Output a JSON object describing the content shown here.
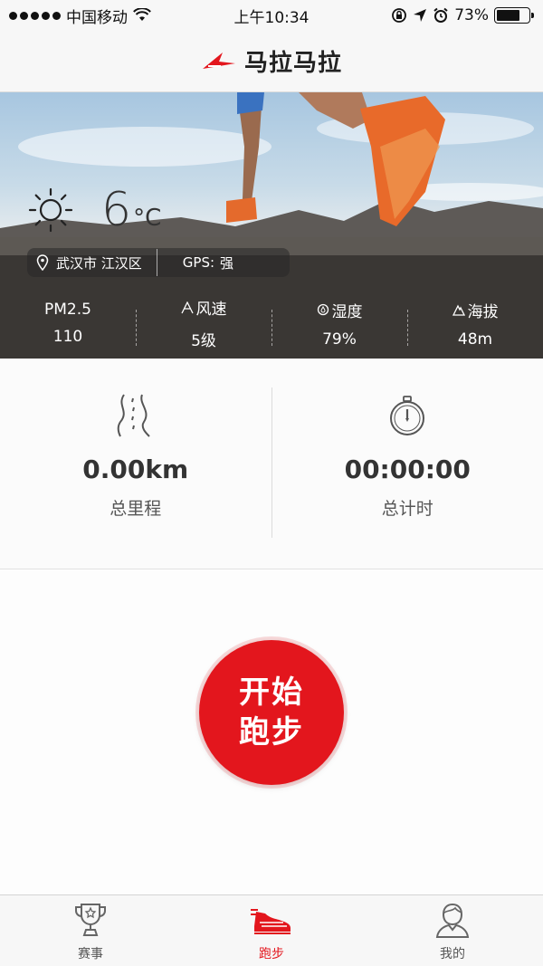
{
  "status_bar": {
    "carrier": "中国移动",
    "time": "上午10:34",
    "battery_percent": "73%",
    "battery_level": 0.73,
    "icons": [
      "signal-dots-icon",
      "wifi-icon",
      "rotation-lock-icon",
      "location-arrow-icon",
      "alarm-icon",
      "battery-icon"
    ]
  },
  "nav": {
    "title": "马拉马拉",
    "logo_icon": "brand-logo-icon"
  },
  "weather": {
    "icon": "sun-icon",
    "temperature": "6",
    "unit": "°C"
  },
  "location": {
    "icon": "location-pin-icon",
    "city": "武汉市 江汉区",
    "gps_label": "GPS:",
    "gps_value": "强"
  },
  "stats": [
    {
      "label": "PM2.5",
      "value": "110",
      "icon": ""
    },
    {
      "label": "风速",
      "value": "5级",
      "icon": "wind-icon"
    },
    {
      "label": "湿度",
      "value": "79%",
      "icon": "humidity-drop-icon"
    },
    {
      "label": "海拔",
      "value": "48m",
      "icon": "mountain-icon"
    }
  ],
  "summary": {
    "distance": {
      "icon": "road-icon",
      "value": "0.00km",
      "label": "总里程"
    },
    "duration": {
      "icon": "stopwatch-icon",
      "value": "00:00:00",
      "label": "总计时"
    }
  },
  "start": {
    "line1": "开始",
    "line2": "跑步"
  },
  "tabs": [
    {
      "label": "赛事",
      "icon": "trophy-icon",
      "active": false
    },
    {
      "label": "跑步",
      "icon": "running-shoe-icon",
      "active": true
    },
    {
      "label": "我的",
      "icon": "user-avatar-icon",
      "active": false
    }
  ],
  "colors": {
    "accent": "#e3161d",
    "text_dark": "#333333",
    "background": "#f4f4f4"
  }
}
